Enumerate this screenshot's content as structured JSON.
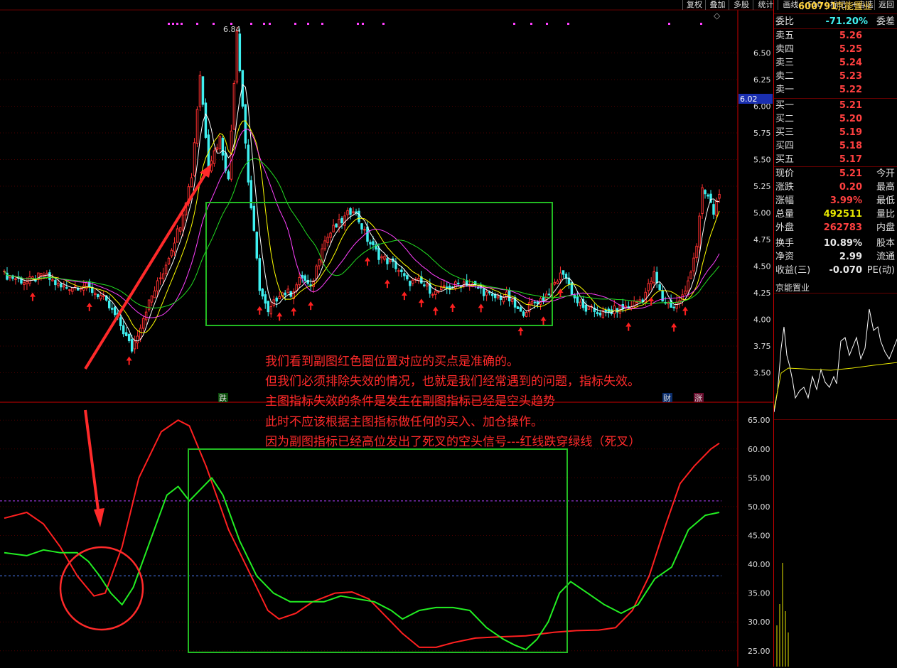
{
  "toolbar": {
    "buttons": [
      "复权",
      "叠加",
      "多股",
      "统计",
      "画线",
      "F10",
      "标记",
      "+自选",
      "返回"
    ]
  },
  "stock": {
    "code": "600791",
    "name": "京能置业"
  },
  "quote": {
    "weibi": {
      "label": "委比",
      "value": "-71.20%",
      "label2": "委差"
    },
    "asks": [
      {
        "label": "卖五",
        "price": "5.26"
      },
      {
        "label": "卖四",
        "price": "5.25"
      },
      {
        "label": "卖三",
        "price": "5.24"
      },
      {
        "label": "卖二",
        "price": "5.23"
      },
      {
        "label": "卖一",
        "price": "5.22"
      }
    ],
    "bids": [
      {
        "label": "买一",
        "price": "5.21"
      },
      {
        "label": "买二",
        "price": "5.20"
      },
      {
        "label": "买三",
        "price": "5.19"
      },
      {
        "label": "买四",
        "price": "5.18"
      },
      {
        "label": "买五",
        "price": "5.17"
      }
    ],
    "stats": [
      {
        "label": "现价",
        "value": "5.21",
        "label2": "今开",
        "color": "#ff4040"
      },
      {
        "label": "涨跌",
        "value": "0.20",
        "label2": "最高",
        "color": "#ff4040"
      },
      {
        "label": "涨幅",
        "value": "3.99%",
        "label2": "最低",
        "color": "#ff4040"
      },
      {
        "label": "总量",
        "value": "492511",
        "label2": "量比",
        "color": "#e8e800"
      },
      {
        "label": "外盘",
        "value": "262783",
        "label2": "内盘",
        "color": "#ff4040"
      },
      {
        "label": "换手",
        "value": "10.89%",
        "label2": "股本",
        "color": "#e8e8e8"
      },
      {
        "label": "净资",
        "value": "2.99",
        "label2": "流通",
        "color": "#e8e8e8"
      },
      {
        "label": "收益(三)",
        "value": "-0.070",
        "label2": "PE(动)",
        "color": "#e8e8e8"
      }
    ],
    "mini_title": "京能置业"
  },
  "colors": {
    "up": "#ff3030",
    "down": "#3ff0f0",
    "ma_white": "#ffffff",
    "ma_yellow": "#ffff00",
    "ma_magenta": "#ff40ff",
    "ma_green": "#22dd22",
    "osc_red": "#ff2020",
    "osc_green": "#22ee22",
    "box": "#22bb22",
    "annotation": "#ff2a2a"
  },
  "badges": {
    "die": "跌",
    "cai": "财",
    "zhang": "涨"
  },
  "annotation_lines": [
    "我们看到副图红色圈位置对应的买点是准确的。",
    "但我们必须排除失效的情况，也就是我们经常遇到的问题，指标失效。",
    "主图指标失效的条件是发生在副图指标已经是空头趋势",
    "此时不应该根据主图指标做任何的买入、加仓操作。",
    "因为副图指标已经高位发出了死叉的空头信号---红线跌穿绿线（死叉）"
  ],
  "chart_data": [
    {
      "type": "candlestick",
      "title": "",
      "y_ticks": [
        3.5,
        3.75,
        4.0,
        4.25,
        4.5,
        4.75,
        5.0,
        5.25,
        5.5,
        5.75,
        6.0,
        6.25,
        6.5
      ],
      "ylim": [
        3.25,
        6.85
      ],
      "peak_label": "6.84",
      "last_price_tag": "6.02",
      "anchors": [
        [
          0,
          4.42
        ],
        [
          8,
          4.35
        ],
        [
          14,
          4.42
        ],
        [
          20,
          4.3
        ],
        [
          28,
          4.32
        ],
        [
          34,
          4.22
        ],
        [
          40,
          4.0
        ],
        [
          45,
          3.72
        ],
        [
          50,
          4.1
        ],
        [
          56,
          4.45
        ],
        [
          62,
          4.9
        ],
        [
          66,
          5.35
        ],
        [
          69,
          6.3
        ],
        [
          72,
          5.45
        ],
        [
          76,
          5.7
        ],
        [
          79,
          5.3
        ],
        [
          82,
          6.72
        ],
        [
          86,
          5.3
        ],
        [
          90,
          4.3
        ],
        [
          93,
          4.05
        ],
        [
          97,
          4.25
        ],
        [
          101,
          4.25
        ],
        [
          105,
          4.4
        ],
        [
          108,
          4.28
        ],
        [
          112,
          4.7
        ],
        [
          116,
          4.85
        ],
        [
          120,
          4.95
        ],
        [
          123,
          5.05
        ],
        [
          128,
          4.75
        ],
        [
          132,
          4.6
        ],
        [
          138,
          4.5
        ],
        [
          142,
          4.35
        ],
        [
          146,
          4.35
        ],
        [
          152,
          4.25
        ],
        [
          157,
          4.3
        ],
        [
          162,
          4.35
        ],
        [
          168,
          4.28
        ],
        [
          172,
          4.2
        ],
        [
          177,
          4.22
        ],
        [
          182,
          4.05
        ],
        [
          186,
          4.15
        ],
        [
          190,
          4.2
        ],
        [
          193,
          4.3
        ],
        [
          197,
          4.45
        ],
        [
          201,
          4.2
        ],
        [
          204,
          4.1
        ],
        [
          208,
          4.08
        ],
        [
          212,
          4.05
        ],
        [
          216,
          4.1
        ],
        [
          220,
          4.12
        ],
        [
          225,
          4.2
        ],
        [
          229,
          4.42
        ],
        [
          232,
          4.18
        ],
        [
          236,
          4.12
        ],
        [
          240,
          4.25
        ],
        [
          244,
          4.7
        ],
        [
          246,
          5.2
        ],
        [
          248,
          5.15
        ],
        [
          250,
          5.0
        ],
        [
          252,
          5.21
        ]
      ],
      "arrow_indices": [
        10,
        30,
        44,
        90,
        97,
        102,
        108,
        128,
        135,
        141,
        147,
        152,
        158,
        168,
        182,
        190,
        196,
        220,
        228,
        236,
        240
      ]
    },
    {
      "type": "line",
      "title": "",
      "y_ticks": [
        25.0,
        30.0,
        35.0,
        40.0,
        45.0,
        50.0,
        55.0,
        60.0,
        65.0
      ],
      "ylim": [
        23.0,
        67.0
      ],
      "dashed_levels": [
        51.0,
        38.0
      ],
      "series": [
        {
          "name": "",
          "color": "red",
          "points": [
            [
              0,
              48
            ],
            [
              8,
              49
            ],
            [
              14,
              47
            ],
            [
              20,
              43
            ],
            [
              26,
              38
            ],
            [
              32,
              34.5
            ],
            [
              36,
              35
            ],
            [
              42,
              43
            ],
            [
              48,
              55
            ],
            [
              56,
              63
            ],
            [
              62,
              65
            ],
            [
              66,
              64
            ],
            [
              72,
              57
            ],
            [
              80,
              46
            ],
            [
              88,
              38
            ],
            [
              94,
              32
            ],
            [
              98,
              30.5
            ],
            [
              104,
              31.5
            ],
            [
              110,
              33.5
            ],
            [
              118,
              35
            ],
            [
              124,
              35.2
            ],
            [
              130,
              34
            ],
            [
              136,
              31
            ],
            [
              142,
              28
            ],
            [
              148,
              25.6
            ],
            [
              154,
              25.6
            ],
            [
              160,
              26.4
            ],
            [
              168,
              27.2
            ],
            [
              176,
              27.4
            ],
            [
              186,
              27.6
            ],
            [
              196,
              28.2
            ],
            [
              204,
              28.5
            ],
            [
              212,
              28.6
            ],
            [
              218,
              29
            ],
            [
              224,
              32
            ],
            [
              230,
              38
            ],
            [
              236,
              47
            ],
            [
              241,
              54
            ],
            [
              246,
              57
            ],
            [
              252,
              60
            ],
            [
              255,
              61
            ]
          ]
        },
        {
          "name": "",
          "color": "green",
          "points": [
            [
              0,
              42
            ],
            [
              8,
              41.5
            ],
            [
              14,
              42.5
            ],
            [
              20,
              42
            ],
            [
              26,
              42
            ],
            [
              30,
              40.5
            ],
            [
              34,
              38
            ],
            [
              38,
              35
            ],
            [
              42,
              33
            ],
            [
              46,
              36
            ],
            [
              52,
              44
            ],
            [
              58,
              52
            ],
            [
              62,
              53.5
            ],
            [
              66,
              51
            ],
            [
              70,
              53
            ],
            [
              74,
              55
            ],
            [
              78,
              52
            ],
            [
              84,
              44
            ],
            [
              90,
              38
            ],
            [
              96,
              35
            ],
            [
              102,
              33.5
            ],
            [
              108,
              33.5
            ],
            [
              114,
              33.5
            ],
            [
              120,
              34.5
            ],
            [
              126,
              34
            ],
            [
              132,
              33.5
            ],
            [
              138,
              32
            ],
            [
              142,
              30.5
            ],
            [
              148,
              32
            ],
            [
              154,
              32.5
            ],
            [
              160,
              32.5
            ],
            [
              166,
              32
            ],
            [
              172,
              29
            ],
            [
              178,
              27
            ],
            [
              182,
              26
            ],
            [
              186,
              25.2
            ],
            [
              190,
              27
            ],
            [
              194,
              30
            ],
            [
              198,
              35
            ],
            [
              202,
              37
            ],
            [
              208,
              35
            ],
            [
              214,
              33
            ],
            [
              220,
              31.5
            ],
            [
              226,
              33
            ],
            [
              232,
              37.5
            ],
            [
              238,
              39.5
            ],
            [
              244,
              46
            ],
            [
              250,
              48.5
            ],
            [
              255,
              49
            ]
          ]
        }
      ]
    }
  ]
}
